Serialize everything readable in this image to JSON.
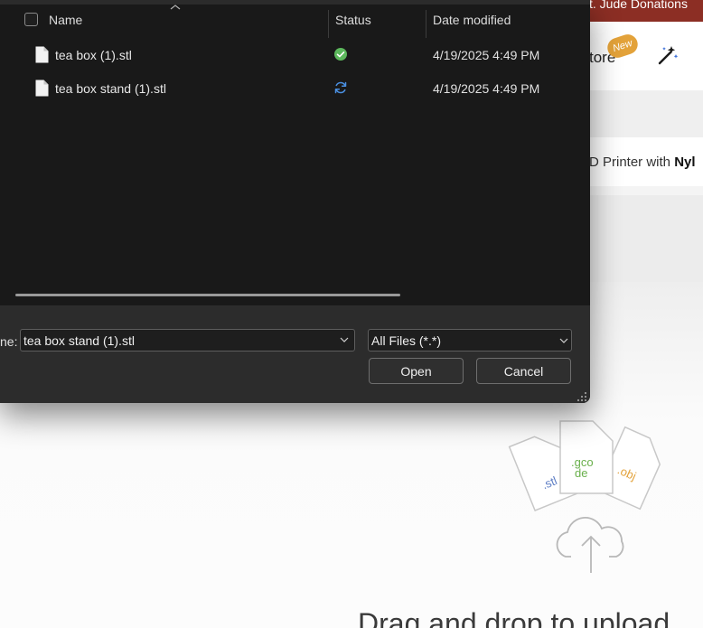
{
  "background_page": {
    "banner_text": "t. Jude Donations",
    "nav_store": "tore",
    "new_badge": "New",
    "promo_text": "D Printer with ",
    "promo_bold": "Nyl",
    "file_types": [
      ".stl",
      ".gco\nde",
      ".obj"
    ],
    "drag_text": "Drag and drop to upload",
    "colors": {
      "banner": "#8c2e24",
      "badge": "#e3a23a",
      "stl": "#5b7cc4",
      "gcode": "#6ab04c",
      "obj": "#e3a23a"
    }
  },
  "dialog": {
    "columns": {
      "name": "Name",
      "status": "Status",
      "date": "Date modified"
    },
    "files": [
      {
        "name": "tea box (1).stl",
        "status_icon": "synced-check-icon",
        "date": "4/19/2025 4:49 PM"
      },
      {
        "name": "tea box stand (1).stl",
        "status_icon": "sync-pending-icon",
        "date": "4/19/2025 4:49 PM"
      }
    ],
    "filename_label": "ne:",
    "filename_value": "tea box stand (1).stl",
    "file_type_filter": "All Files (*.*)",
    "open_label": "Open",
    "cancel_label": "Cancel",
    "colors": {
      "synced": "#5cb85c",
      "sync": "#4a90e2"
    }
  }
}
